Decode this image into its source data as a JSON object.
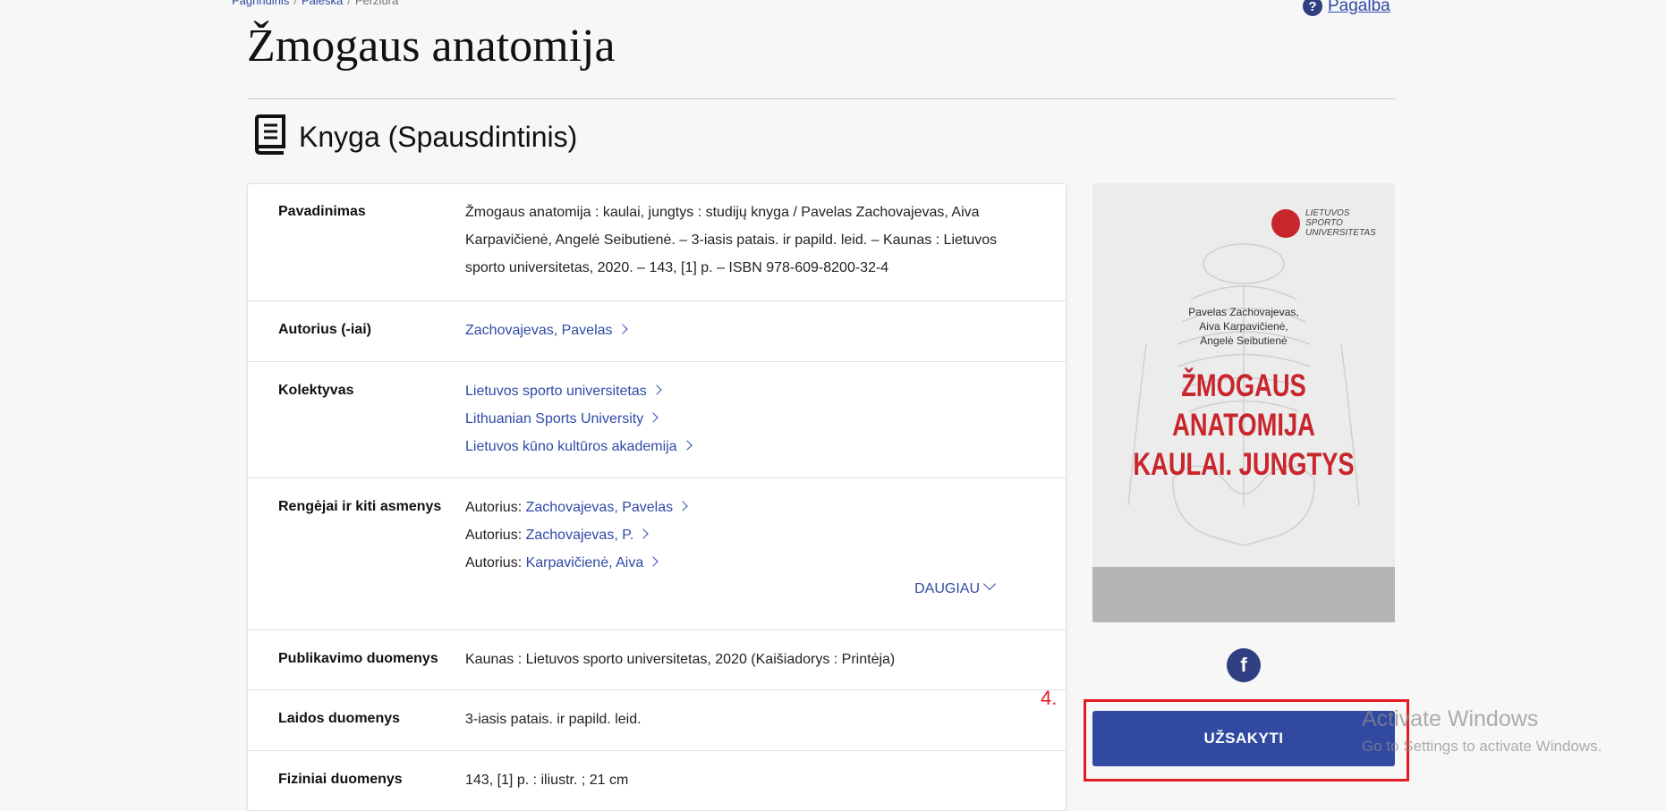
{
  "breadcrumb": {
    "home": "Pagrindinis",
    "search": "Paieška",
    "current": "Peržiūra"
  },
  "help": {
    "icon": "question-circle-icon",
    "label": "Pagalba"
  },
  "page_title": "Žmogaus anatomija",
  "record_type": {
    "icon": "book-icon",
    "label": "Knyga (Spausdintinis)"
  },
  "details": {
    "title": {
      "label": "Pavadinimas",
      "line1": "Žmogaus anatomija : kaulai, jungtys : studijų knyga / Pavelas Zachovajevas, Aiva",
      "line2": "Karpavičienė, Angelė Seibutienė. – 3-iasis patais. ir papild. leid. – Kaunas : Lietuvos",
      "line3": "sporto universitetas, 2020. – 143, [1] p. – ISBN 978-609-8200-32-4"
    },
    "authors": {
      "label": "Autorius (-iai)",
      "items": [
        "Zachovajevas, Pavelas"
      ]
    },
    "collective": {
      "label": "Kolektyvas",
      "items": [
        "Lietuvos sporto universitetas",
        "Lithuanian Sports University",
        "Lietuvos kūno kultūros akademija"
      ]
    },
    "contributors": {
      "label": "Rengėjai ir kiti asmenys",
      "role": "Autorius:",
      "items": [
        "Zachovajevas, Pavelas",
        "Zachovajevas, P.",
        "Karpavičienė, Aiva"
      ],
      "more": "DAUGIAU"
    },
    "publication": {
      "label": "Publikavimo duomenys",
      "value": "Kaunas : Lietuvos sporto universitetas, 2020 (Kaišiadorys : Printėja)"
    },
    "edition": {
      "label": "Laidos duomenys",
      "value": "3-iasis patais. ir papild. leid."
    },
    "physical": {
      "label": "Fiziniai duomenys",
      "value": "143, [1] p. : iliustr. ; 21 cm"
    }
  },
  "cover": {
    "publisher_line1": "LIETUVOS",
    "publisher_line2": "SPORTO",
    "publisher_line3": "UNIVERSITETAS",
    "author1": "Pavelas Zachovajevas,",
    "author2": "Aiva Karpavičienė,",
    "author3": "Angelė Seibutienė",
    "title1": "ŽMOGAUS ANATOMIJA",
    "title2": "KAULAI. JUNGTYS",
    "accent_color": "#c8252c"
  },
  "share": {
    "icon": "facebook-icon",
    "glyph": "f"
  },
  "annotation": {
    "step": "4."
  },
  "order_button": "UŽSAKYTI",
  "watermark": {
    "title": "Activate Windows",
    "subtitle": "Go to Settings to activate Windows."
  },
  "colors": {
    "primary": "#3149a0",
    "link": "#2f4aa5",
    "highlight": "#e31b23"
  }
}
